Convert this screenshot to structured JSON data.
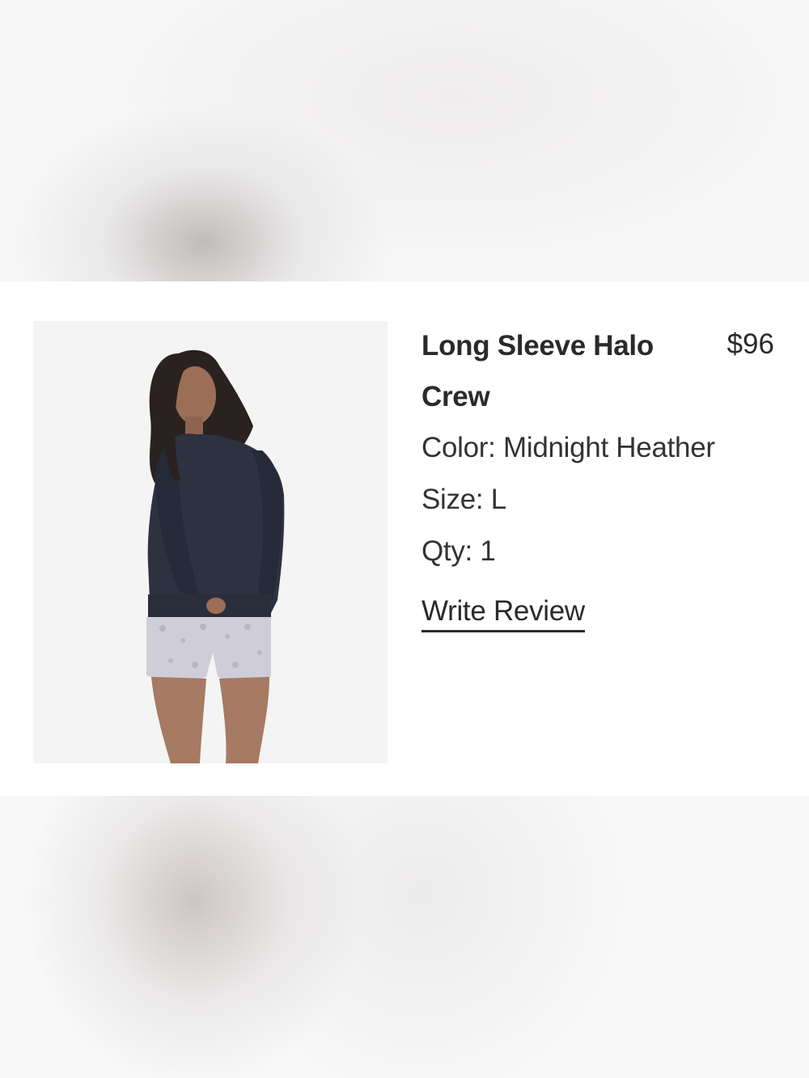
{
  "product": {
    "name": "Long Sleeve Halo Crew",
    "price": "$96",
    "color_label": "Color: Midnight Heather",
    "size_label": "Size: L",
    "qty_label": "Qty: 1",
    "write_review_label": "Write Review"
  },
  "colors": {
    "text": "#2a2a2a",
    "sweater": "#2d3140",
    "image_bg": "#f4f4f4"
  }
}
